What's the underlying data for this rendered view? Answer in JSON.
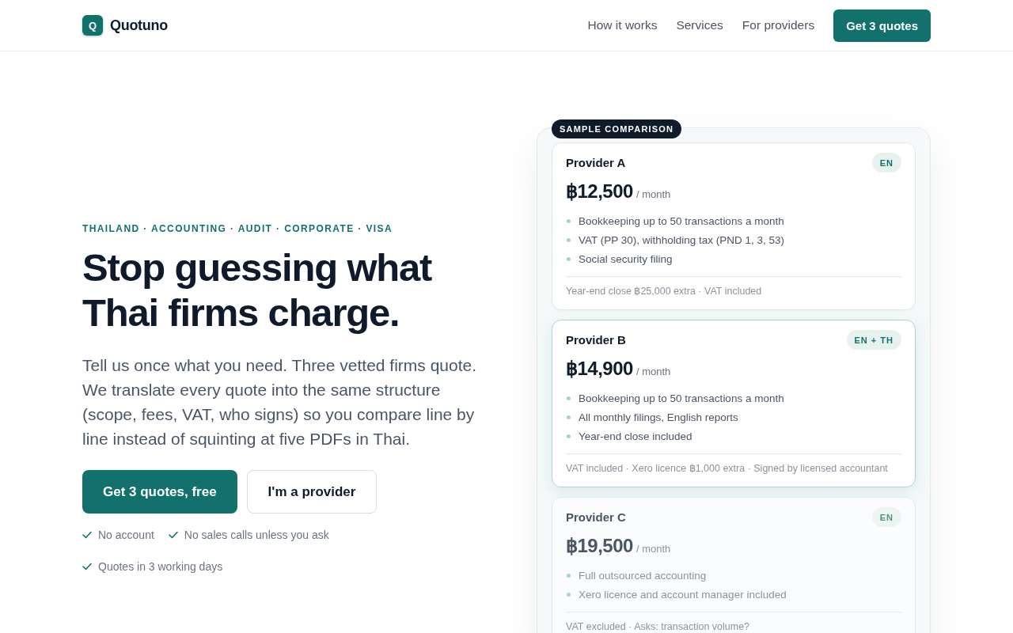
{
  "header": {
    "logo": {
      "mark": "Q",
      "name": "Quotuno"
    },
    "nav": [
      {
        "label": "How it works"
      },
      {
        "label": "Services"
      },
      {
        "label": "For providers"
      }
    ],
    "cta": "Get 3 quotes"
  },
  "hero": {
    "eyebrow": "THAILAND · ACCOUNTING · AUDIT · CORPORATE · VISA",
    "heading": "Stop guessing what Thai firms charge.",
    "lead": "Tell us once what you need. Three vetted firms quote. We translate every quote into the same structure (scope, fees, VAT, who signs) so you compare line by line instead of squinting at five PDFs in Thai.",
    "buttons": [
      {
        "label": "Get 3 quotes, free",
        "kind": "primary"
      },
      {
        "label": "I'm a provider",
        "kind": "secondary"
      }
    ],
    "assurances": [
      "No account",
      "No sales calls unless you ask",
      "Quotes in 3 working days"
    ]
  },
  "comparison": {
    "badge": "SAMPLE COMPARISON",
    "providers": [
      {
        "name": "Provider A",
        "language": "EN",
        "price": "฿12,500",
        "period": "/ month",
        "features": [
          "Bookkeeping up to 50 transactions a month",
          "VAT (PP 30), withholding tax (PND 1, 3, 53)",
          "Social security filing"
        ],
        "note": "Year-end close ฿25,000 extra · VAT included",
        "highlighted": false,
        "dimmed": false
      },
      {
        "name": "Provider B",
        "language": "EN + TH",
        "price": "฿14,900",
        "period": "/ month",
        "features": [
          "Bookkeeping up to 50 transactions a month",
          "All monthly filings, English reports",
          "Year-end close included"
        ],
        "note": "VAT included · Xero licence ฿1,000 extra · Signed by licensed accountant",
        "highlighted": true,
        "dimmed": false
      },
      {
        "name": "Provider C",
        "language": "EN",
        "price": "฿19,500",
        "period": "/ month",
        "features": [
          "Full outsourced accounting",
          "Xero licence and account manager included"
        ],
        "note": "VAT excluded · Asks: transaction volume?",
        "highlighted": false,
        "dimmed": true
      }
    ]
  }
}
